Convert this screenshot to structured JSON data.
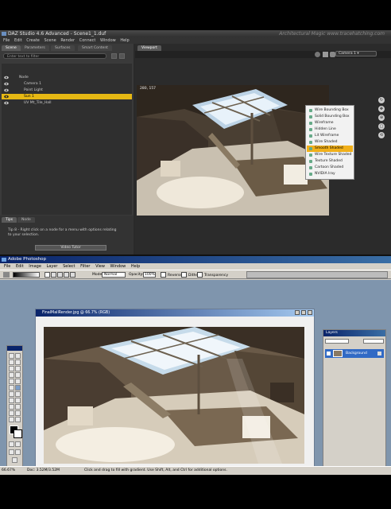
{
  "daz": {
    "title": "DAZ Studio 4.6 Advanced - Scene1_1.duf",
    "watermark": "Architectural Magic  www.tracehatching.com",
    "menu": [
      "File",
      "Edit",
      "Create",
      "Scene",
      "Render",
      "Connect",
      "Window",
      "Help"
    ],
    "left_tabs": [
      "Scene",
      "Parameters",
      "Surfaces",
      "Smart Content"
    ],
    "search_placeholder": "Enter text to filter",
    "scene_items": [
      {
        "label": "Node",
        "selected": false,
        "indent": 0
      },
      {
        "label": "Camera 1",
        "selected": false,
        "indent": 1
      },
      {
        "label": "Point Light",
        "selected": false,
        "indent": 1
      },
      {
        "label": "Sun 1",
        "selected": true,
        "indent": 1
      },
      {
        "label": "UV Mt_Tile_Hall",
        "selected": false,
        "indent": 1
      }
    ],
    "tips_tabs": [
      "Tips",
      "Node"
    ],
    "tip_text": "Tip 8 - Right click on a node for a menu with options relating to your selection.",
    "video_button": "Video Tutor",
    "viewport_tab": "Viewport",
    "viewport_coords": "280, 157",
    "camera_select": "Camera 1",
    "draw_menu": [
      {
        "label": "Wire Bounding Box",
        "highlighted": false
      },
      {
        "label": "Solid Bounding Box",
        "highlighted": false
      },
      {
        "label": "Wireframe",
        "highlighted": false
      },
      {
        "label": "Hidden Line",
        "highlighted": false
      },
      {
        "label": "Lit Wireframe",
        "highlighted": false
      },
      {
        "label": "Wire Shaded",
        "highlighted": false
      },
      {
        "label": "Smooth Shaded",
        "highlighted": true
      },
      {
        "label": "Wire Texture Shaded",
        "highlighted": false
      },
      {
        "label": "Texture Shaded",
        "highlighted": false
      },
      {
        "label": "Cartoon Shaded",
        "highlighted": false
      },
      {
        "label": "NVIDIA Iray",
        "highlighted": false
      }
    ],
    "side_icons": [
      "rotate-icon",
      "pan-icon",
      "zoom-icon",
      "frame-icon",
      "reset-icon"
    ]
  },
  "ps": {
    "title": "Adobe Photoshop",
    "menu": [
      "File",
      "Edit",
      "Image",
      "Layer",
      "Select",
      "Filter",
      "View",
      "Window",
      "Help"
    ],
    "options": {
      "mode_label": "Mode:",
      "mode_value": "Normal",
      "opacity_label": "Opacity:",
      "opacity_value": "100%",
      "reverse": "Reverse",
      "dither": "Dither",
      "transparency": "Transparency"
    },
    "doc_title": "FinalMallRender.jpg @ 66.7% (RGB)",
    "layers_title": "Layers",
    "layer_name": "Background",
    "status_zoom": "66.67%",
    "status_doc": "Doc: 3.52M/3.52M",
    "status_hint": "Click and drag to fill with gradient. Use Shift, Alt, and Ctrl for additional options."
  },
  "colors": {
    "selection_yellow": "#e6b814",
    "menu_highlight": "#f1b01a",
    "ps_workspace": "#7f95ad",
    "ps_titlebar": "#0a246a"
  }
}
